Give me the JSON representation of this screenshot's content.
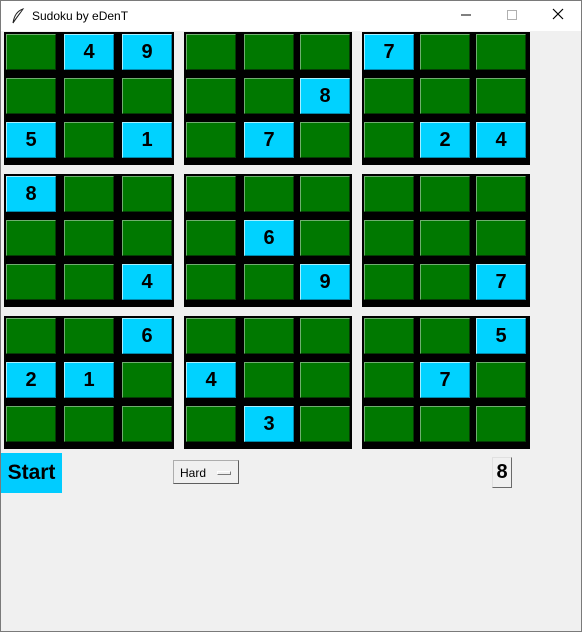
{
  "window": {
    "title": "Sudoku by eDenT",
    "controls": {
      "minimize_icon": "minimize-icon",
      "maximize_icon": "maximize-icon",
      "close_icon": "close-icon"
    }
  },
  "colors": {
    "empty_cell": "#007800",
    "given_cell": "#00d2ff",
    "grid_line": "#000000",
    "start_button": "#00ccff"
  },
  "board": {
    "rows": [
      [
        "",
        "4",
        "9",
        "",
        "",
        "",
        "7",
        "",
        ""
      ],
      [
        "",
        "",
        "",
        "",
        "",
        "8",
        "",
        "",
        ""
      ],
      [
        "5",
        "",
        "1",
        "",
        "7",
        "",
        "",
        "2",
        "4"
      ],
      [
        "8",
        "",
        "",
        "",
        "",
        "",
        "",
        "",
        ""
      ],
      [
        "",
        "",
        "",
        "",
        "6",
        "",
        "",
        "",
        ""
      ],
      [
        "",
        "",
        "4",
        "",
        "",
        "9",
        "",
        "",
        "7"
      ],
      [
        "",
        "",
        "6",
        "",
        "",
        "",
        "",
        "",
        "5"
      ],
      [
        "2",
        "1",
        "",
        "4",
        "",
        "",
        "",
        "7",
        ""
      ],
      [
        "",
        "",
        "",
        "",
        "3",
        "",
        "",
        "",
        ""
      ]
    ]
  },
  "controls": {
    "start_label": "Start",
    "difficulty_selected": "Hard",
    "number_selected": "8"
  }
}
